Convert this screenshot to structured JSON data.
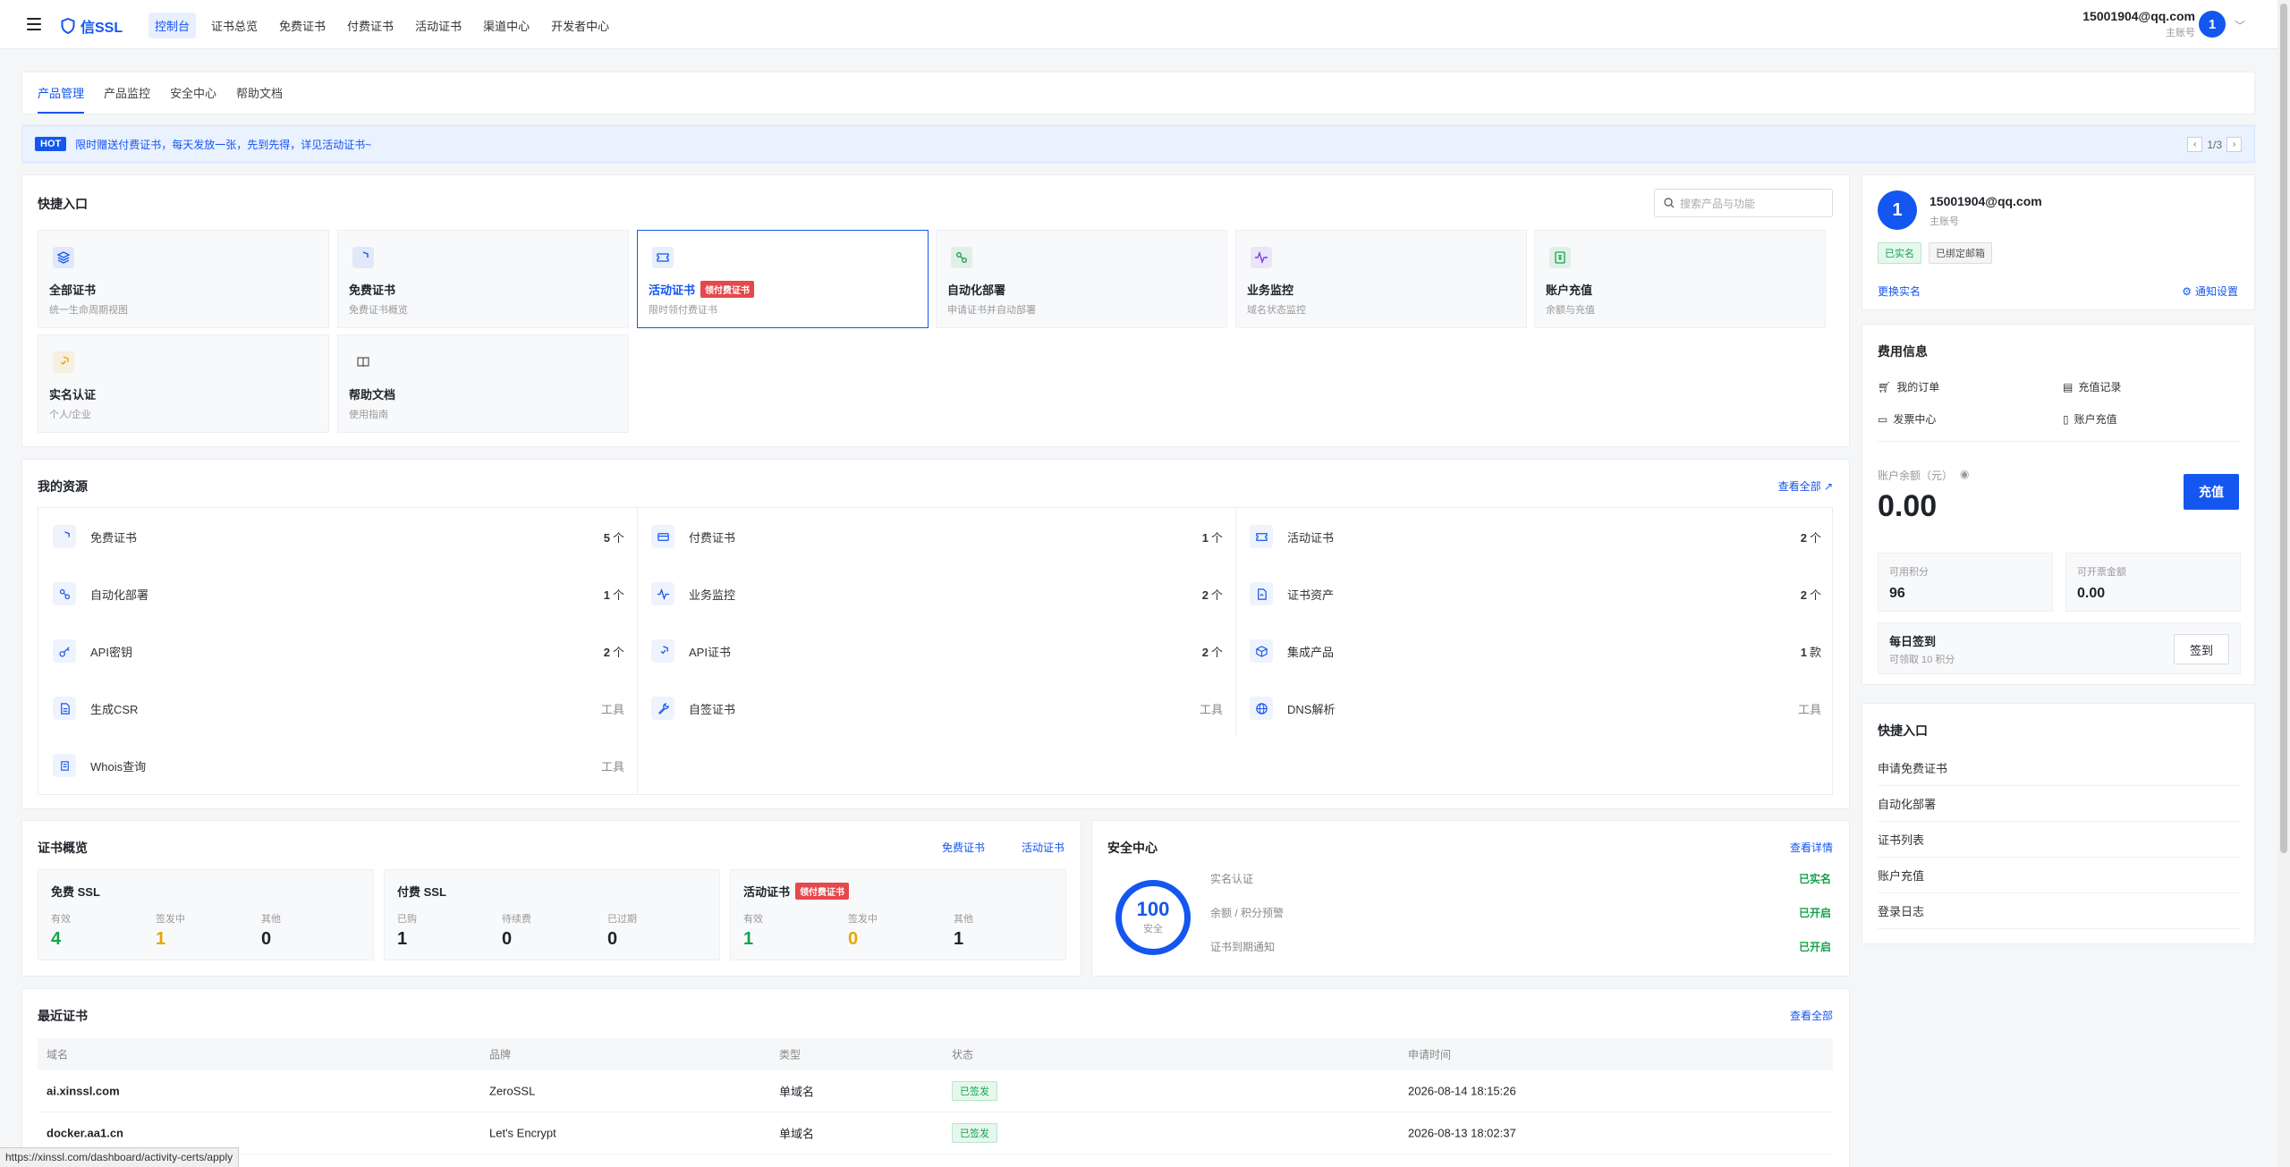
{
  "topbar": {
    "logo": "信SSL",
    "nav": [
      "控制台",
      "证书总览",
      "免费证书",
      "付费证书",
      "活动证书",
      "渠道中心",
      "开发者中心"
    ],
    "user_email": "15001904@qq.com",
    "user_role": "主账号",
    "avatar": "1"
  },
  "tabs": [
    "产品管理",
    "产品监控",
    "安全中心",
    "帮助文档"
  ],
  "banner": {
    "badge": "HOT",
    "text": "限时赠送付费证书，每天发放一张，先到先得，详见活动证书~",
    "page": "1/3"
  },
  "quick": {
    "title": "快捷入口",
    "search_placeholder": "搜索产品与功能",
    "cards": [
      {
        "title": "全部证书",
        "sub": "统一生命周期视图",
        "icon": "layers-icon",
        "color": "#1456f0"
      },
      {
        "title": "免费证书",
        "sub": "免费证书概览",
        "icon": "shield-icon",
        "color": "#1456f0"
      },
      {
        "title": "活动证书",
        "sub": "限时领付费证书",
        "icon": "ticket-icon",
        "color": "#1456f0",
        "tag": "领付费证书"
      },
      {
        "title": "自动化部署",
        "sub": "申请证书并自动部署",
        "icon": "deploy-icon",
        "color": "#16a34a"
      },
      {
        "title": "业务监控",
        "sub": "域名状态监控",
        "icon": "pulse-icon",
        "color": "#7c3aed"
      },
      {
        "title": "账户充值",
        "sub": "余额与充值",
        "icon": "wallet-icon",
        "color": "#16a34a"
      },
      {
        "title": "实名认证",
        "sub": "个人/企业",
        "icon": "verify-icon",
        "color": "#e6a700"
      },
      {
        "title": "帮助文档",
        "sub": "使用指南",
        "icon": "book-icon",
        "color": "#555"
      }
    ]
  },
  "resources": {
    "title": "我的资源",
    "view_all": "查看全部 ↗",
    "items": [
      {
        "label": "免费证书",
        "count": "5",
        "unit": "个",
        "icon": "shield-icon"
      },
      {
        "label": "付费证书",
        "count": "1",
        "unit": "个",
        "icon": "card-icon"
      },
      {
        "label": "活动证书",
        "count": "2",
        "unit": "个",
        "icon": "ticket-icon"
      },
      {
        "label": "自动化部署",
        "count": "1",
        "unit": "个",
        "icon": "deploy-icon"
      },
      {
        "label": "业务监控",
        "count": "2",
        "unit": "个",
        "icon": "pulse-icon"
      },
      {
        "label": "证书资产",
        "count": "2",
        "unit": "个",
        "icon": "asset-icon"
      },
      {
        "label": "API密钥",
        "count": "2",
        "unit": "个",
        "icon": "key-icon"
      },
      {
        "label": "API证书",
        "count": "2",
        "unit": "个",
        "icon": "shield-check-icon"
      },
      {
        "label": "集成产品",
        "count": "1",
        "unit": "款",
        "icon": "cube-icon"
      },
      {
        "label": "生成CSR",
        "count": "",
        "unit": "工具",
        "icon": "file-icon"
      },
      {
        "label": "自签证书",
        "count": "",
        "unit": "工具",
        "icon": "wrench-icon"
      },
      {
        "label": "DNS解析",
        "count": "",
        "unit": "工具",
        "icon": "globe-icon"
      },
      {
        "label": "Whois查询",
        "count": "",
        "unit": "工具",
        "icon": "scroll-icon"
      }
    ]
  },
  "cert_overview": {
    "title": "证书概览",
    "link_free": "免费证书",
    "link_activity": "活动证书",
    "cards": [
      {
        "title": "免费 SSL",
        "stats": [
          {
            "label": "有效",
            "value": "4",
            "color": "#16a34a"
          },
          {
            "label": "签发中",
            "value": "1",
            "color": "#e6a700"
          },
          {
            "label": "其他",
            "value": "0",
            "color": "#1f2329"
          }
        ]
      },
      {
        "title": "付费 SSL",
        "stats": [
          {
            "label": "已购",
            "value": "1",
            "color": "#1f2329"
          },
          {
            "label": "待续费",
            "value": "0",
            "color": "#1f2329"
          },
          {
            "label": "已过期",
            "value": "0",
            "color": "#1f2329"
          }
        ]
      },
      {
        "title": "活动证书",
        "tag": "领付费证书",
        "stats": [
          {
            "label": "有效",
            "value": "1",
            "color": "#16a34a"
          },
          {
            "label": "签发中",
            "value": "0",
            "color": "#e6a700"
          },
          {
            "label": "其他",
            "value": "1",
            "color": "#1f2329"
          }
        ]
      }
    ]
  },
  "security": {
    "title": "安全中心",
    "link": "查看详情",
    "score": "100",
    "score_label": "安全",
    "rows": [
      {
        "label": "实名认证",
        "value": "已实名"
      },
      {
        "label": "余额 / 积分预警",
        "value": "已开启"
      },
      {
        "label": "证书到期通知",
        "value": "已开启"
      }
    ]
  },
  "recent": {
    "title": "最近证书",
    "link": "查看全部",
    "headers": [
      "域名",
      "品牌",
      "类型",
      "状态",
      "申请时间"
    ],
    "rows": [
      {
        "domain": "ai.xinssl.com",
        "brand": "ZeroSSL",
        "type": "单域名",
        "status": "已签发",
        "time": "2026-08-14 18:15:26"
      },
      {
        "domain": "docker.aa1.cn",
        "brand": "Let's Encrypt",
        "type": "单域名",
        "status": "已签发",
        "time": "2026-08-13 18:02:37"
      }
    ]
  },
  "user_card": {
    "avatar": "1",
    "email": "15001904@qq.com",
    "role": "主账号",
    "badges": [
      "已实名",
      "已绑定邮箱"
    ],
    "link_left": "更换实名",
    "link_right": "通知设置"
  },
  "fee": {
    "title": "费用信息",
    "links": [
      "我的订单",
      "充值记录",
      "发票中心",
      "账户充值"
    ],
    "balance_label": "账户余额（元）",
    "balance": "0.00",
    "recharge": "充值",
    "points_label": "可用积分",
    "points": "96",
    "invoice_label": "可开票金额",
    "invoice": "0.00",
    "signin_title": "每日签到",
    "signin_sub": "可领取 10 积分",
    "signin_btn": "签到"
  },
  "quick2": {
    "title": "快捷入口",
    "items": [
      "申请免费证书",
      "自动化部署",
      "证书列表",
      "账户充值",
      "登录日志"
    ]
  },
  "statusbar": "https://xinssl.com/dashboard/activity-certs/apply"
}
